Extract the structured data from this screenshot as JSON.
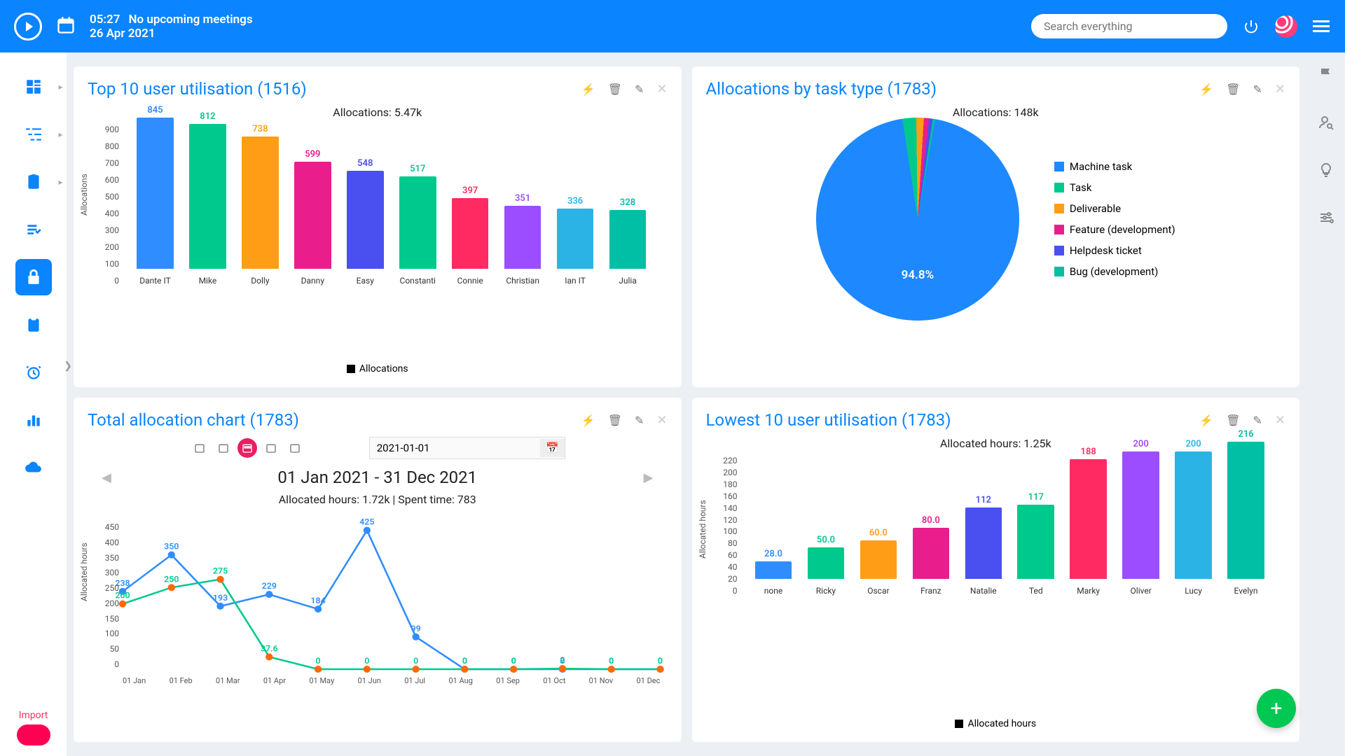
{
  "header": {
    "time": "05:27",
    "meeting_status": "No upcoming meetings",
    "date": "26 Apr 2021",
    "search_placeholder": "Search everything"
  },
  "sidebar": {
    "import_label": "Import"
  },
  "cards": {
    "top10": {
      "title": "Top 10 user utilisation (1516)",
      "subtitle": "Allocations: 5.47k",
      "ylabel": "Allocations",
      "legend": "Allocations"
    },
    "tasktype": {
      "title": "Allocations by task type (1783)",
      "subtitle": "Allocations: 148k",
      "main_pct": "94.8%"
    },
    "total": {
      "title": "Total allocation chart (1783)",
      "date_value": "2021-01-01",
      "range": "01 Jan 2021 - 31 Dec 2021",
      "summary": "Allocated hours: 1.72k | Spent time: 783",
      "ylabel": "Allocated hours"
    },
    "lowest": {
      "title": "Lowest 10 user utilisation (1783)",
      "subtitle": "Allocated hours: 1.25k",
      "ylabel": "Allocated hours",
      "legend": "Allocated hours"
    }
  },
  "chart_data": [
    {
      "id": "top10",
      "type": "bar",
      "title": "Top 10 user utilisation (1516)",
      "subtitle": "Allocations: 5.47k",
      "ylabel": "Allocations",
      "ylim": [
        0,
        900
      ],
      "yticks": [
        0,
        100,
        200,
        300,
        400,
        500,
        600,
        700,
        800,
        900
      ],
      "categories": [
        "Dante IT",
        "Mike",
        "Dolly",
        "Danny",
        "Easy",
        "Constanti",
        "Connie",
        "Christian",
        "Ian IT",
        "Julia"
      ],
      "values": [
        845,
        812,
        738,
        599,
        548,
        517,
        397,
        351,
        336,
        328
      ],
      "colors": [
        "#2f8dff",
        "#00c98d",
        "#ff9e16",
        "#e91e8c",
        "#4a4ff0",
        "#00c98d",
        "#ff2a61",
        "#9b4dff",
        "#2bb3e6",
        "#00bfa5"
      ],
      "legend": "Allocations"
    },
    {
      "id": "tasktype",
      "type": "pie",
      "title": "Allocations by task type (1783)",
      "subtitle": "Allocations: 148k",
      "series": [
        {
          "name": "Machine task",
          "pct": 94.8,
          "color": "#1e88ff"
        },
        {
          "name": "Task",
          "pct": 2.2,
          "color": "#00c98d"
        },
        {
          "name": "Deliverable",
          "pct": 1.2,
          "color": "#ff9e16"
        },
        {
          "name": "Feature (development)",
          "pct": 0.8,
          "color": "#e91e8c"
        },
        {
          "name": "Helpdesk ticket",
          "pct": 0.6,
          "color": "#4a4ff0"
        },
        {
          "name": "Bug (development)",
          "pct": 0.4,
          "color": "#00bfa5"
        }
      ]
    },
    {
      "id": "total",
      "type": "line",
      "title": "Total allocation chart (1783)",
      "xlabel": "",
      "ylabel": "Allocated hours",
      "ylim": [
        0,
        450
      ],
      "yticks": [
        0,
        50,
        100,
        150,
        200,
        250,
        300,
        350,
        400,
        450
      ],
      "x": [
        "01 Jan",
        "01 Feb",
        "01 Mar",
        "01 Apr",
        "01 May",
        "01 Jun",
        "01 Jul",
        "01 Aug",
        "01 Sep",
        "01 Oct",
        "01 Nov",
        "01 Dec"
      ],
      "series": [
        {
          "name": "Allocated hours",
          "color": "#2f8dff",
          "values": [
            238,
            350,
            193,
            229,
            184,
            425,
            99.0,
            0,
            0,
            0,
            0,
            0
          ]
        },
        {
          "name": "Spent time",
          "color": "#00c98d",
          "values": [
            200,
            250,
            275,
            37.6,
            0,
            0,
            0,
            0,
            0,
            2.0,
            0,
            0
          ],
          "point_color": "#ff6a00"
        }
      ],
      "summary": "Allocated hours: 1.72k | Spent time: 783",
      "range": "01 Jan 2021 - 31 Dec 2021"
    },
    {
      "id": "lowest",
      "type": "bar",
      "title": "Lowest 10 user utilisation (1783)",
      "subtitle": "Allocated hours: 1.25k",
      "ylabel": "Allocated hours",
      "ylim": [
        0,
        220
      ],
      "yticks": [
        0,
        20,
        40,
        60,
        80,
        100,
        120,
        140,
        160,
        180,
        200,
        220
      ],
      "categories": [
        "none",
        "Ricky",
        "Oscar",
        "Franz",
        "Natalie",
        "Ted",
        "Marky",
        "Oliver",
        "Lucy",
        "Evelyn"
      ],
      "values": [
        28.0,
        50.0,
        60.0,
        80.0,
        112,
        117,
        188,
        200,
        200,
        216
      ],
      "value_labels": [
        "28.0",
        "50.0",
        "60.0",
        "80.0",
        "112",
        "117",
        "188",
        "200",
        "200",
        "216"
      ],
      "colors": [
        "#2f8dff",
        "#00c98d",
        "#ff9e16",
        "#e91e8c",
        "#4a4ff0",
        "#00c98d",
        "#ff2a61",
        "#9b4dff",
        "#2bb3e6",
        "#00bfa5"
      ],
      "legend": "Allocated hours"
    }
  ],
  "pie_legend": [
    {
      "name": "Machine task",
      "color": "#1e88ff"
    },
    {
      "name": "Task",
      "color": "#00c98d"
    },
    {
      "name": "Deliverable",
      "color": "#ff9e16"
    },
    {
      "name": "Feature (development)",
      "color": "#e91e8c"
    },
    {
      "name": "Helpdesk ticket",
      "color": "#4a4ff0"
    },
    {
      "name": "Bug (development)",
      "color": "#00bfa5"
    }
  ]
}
